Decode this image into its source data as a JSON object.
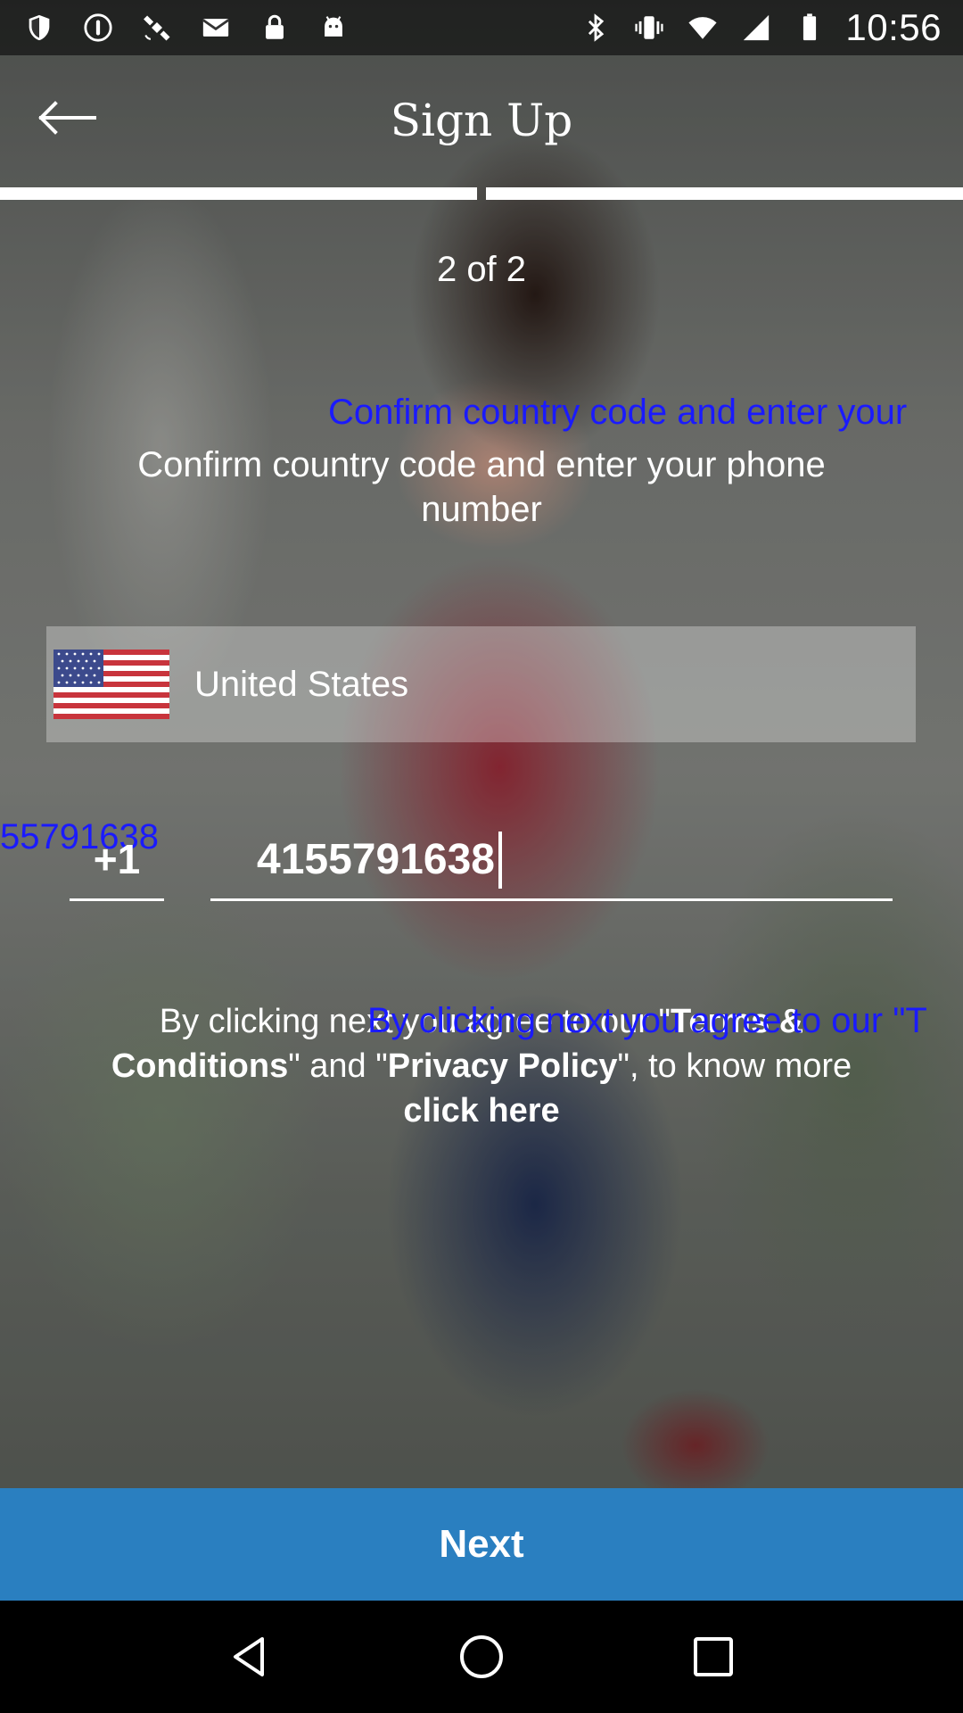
{
  "status_bar": {
    "time": "10:56",
    "left_icons": [
      "shield-icon",
      "info-circle-icon",
      "satellite-fake-gps-icon",
      "gmail-icon",
      "lock-icon",
      "android-icon"
    ],
    "right_icons": [
      "bluetooth-icon",
      "vibrate-icon",
      "wifi-icon",
      "signal-icon",
      "battery-icon"
    ]
  },
  "header": {
    "title": "Sign Up",
    "back_icon": "arrow-left-icon"
  },
  "progress": {
    "current_step": 2,
    "total_steps": 2,
    "label": "2 of 2"
  },
  "form": {
    "instruction": "Confirm country code and enter your phone number",
    "country": {
      "name": "United States",
      "flag": "us-flag-icon"
    },
    "dial_code": "+1",
    "phone_value": "4155791638"
  },
  "terms": {
    "prefix": "By clicking next you agree to our \"",
    "terms_label": "Terms & Conditions",
    "middle": "\" and \"",
    "privacy_label": "Privacy Policy",
    "suffix": "\", to know more",
    "link_label": "click here"
  },
  "overlay": {
    "instruction_ghost": "Confirm country code and enter your",
    "phone_ghost": "55791638",
    "terms_ghost": "By clicking next you agree to our \"T"
  },
  "primary_action": {
    "label": "Next",
    "color": "#2a7fc0"
  },
  "nav_bar": {
    "icons": [
      "back-triangle-icon",
      "home-circle-icon",
      "recents-square-icon"
    ]
  }
}
